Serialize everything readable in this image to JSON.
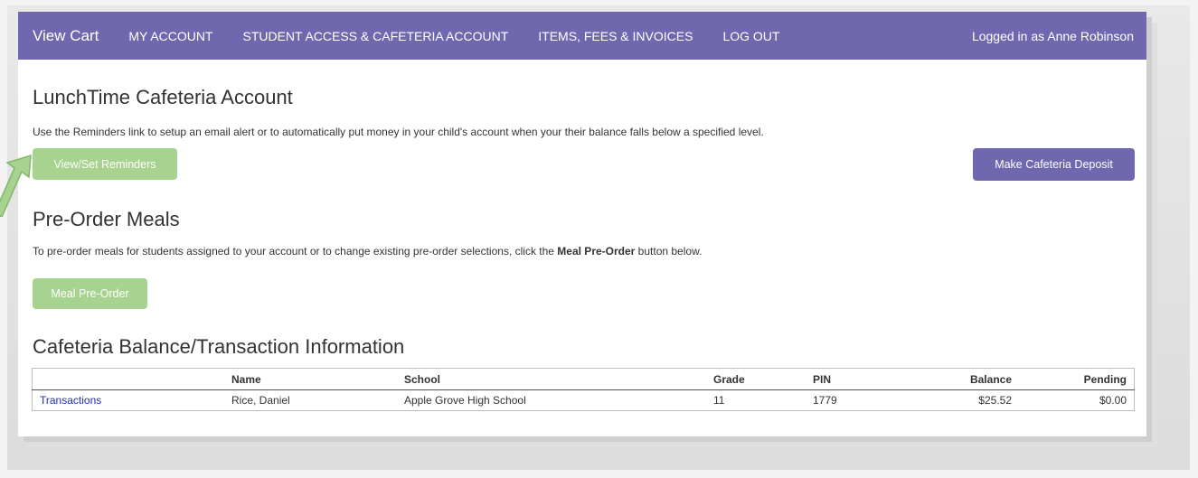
{
  "navbar": {
    "brand": "View Cart",
    "links": [
      "MY ACCOUNT",
      "STUDENT ACCESS & CAFETERIA ACCOUNT",
      "ITEMS, FEES & INVOICES",
      "LOG OUT"
    ],
    "user": "Logged in as Anne Robinson"
  },
  "lunch": {
    "title": "LunchTime Cafeteria Account",
    "description": "Use the Reminders link to setup an email alert or to automatically put money in your child's account when your their balance falls below a specified level.",
    "reminders_button": "View/Set Reminders",
    "deposit_button": "Make Cafeteria Deposit"
  },
  "preorder": {
    "title": "Pre-Order Meals",
    "text_before": "To pre-order meals for students assigned to your account or to change existing pre-order selections, click the ",
    "text_bold": "Meal Pre-Order",
    "text_after": " button below.",
    "button": "Meal Pre-Order"
  },
  "balance": {
    "title": "Cafeteria Balance/Transaction Information",
    "columns": [
      "",
      "Name",
      "School",
      "Grade",
      "PIN",
      "Balance",
      "Pending"
    ],
    "rows": [
      {
        "link": "Transactions",
        "name": "Rice, Daniel",
        "school": "Apple Grove High School",
        "grade": "11",
        "pin": "1779",
        "balance": "$25.52",
        "pending": "$0.00"
      }
    ]
  },
  "colors": {
    "accent": "#7068ae",
    "green": "#a7d28f",
    "link": "#2230b8"
  }
}
